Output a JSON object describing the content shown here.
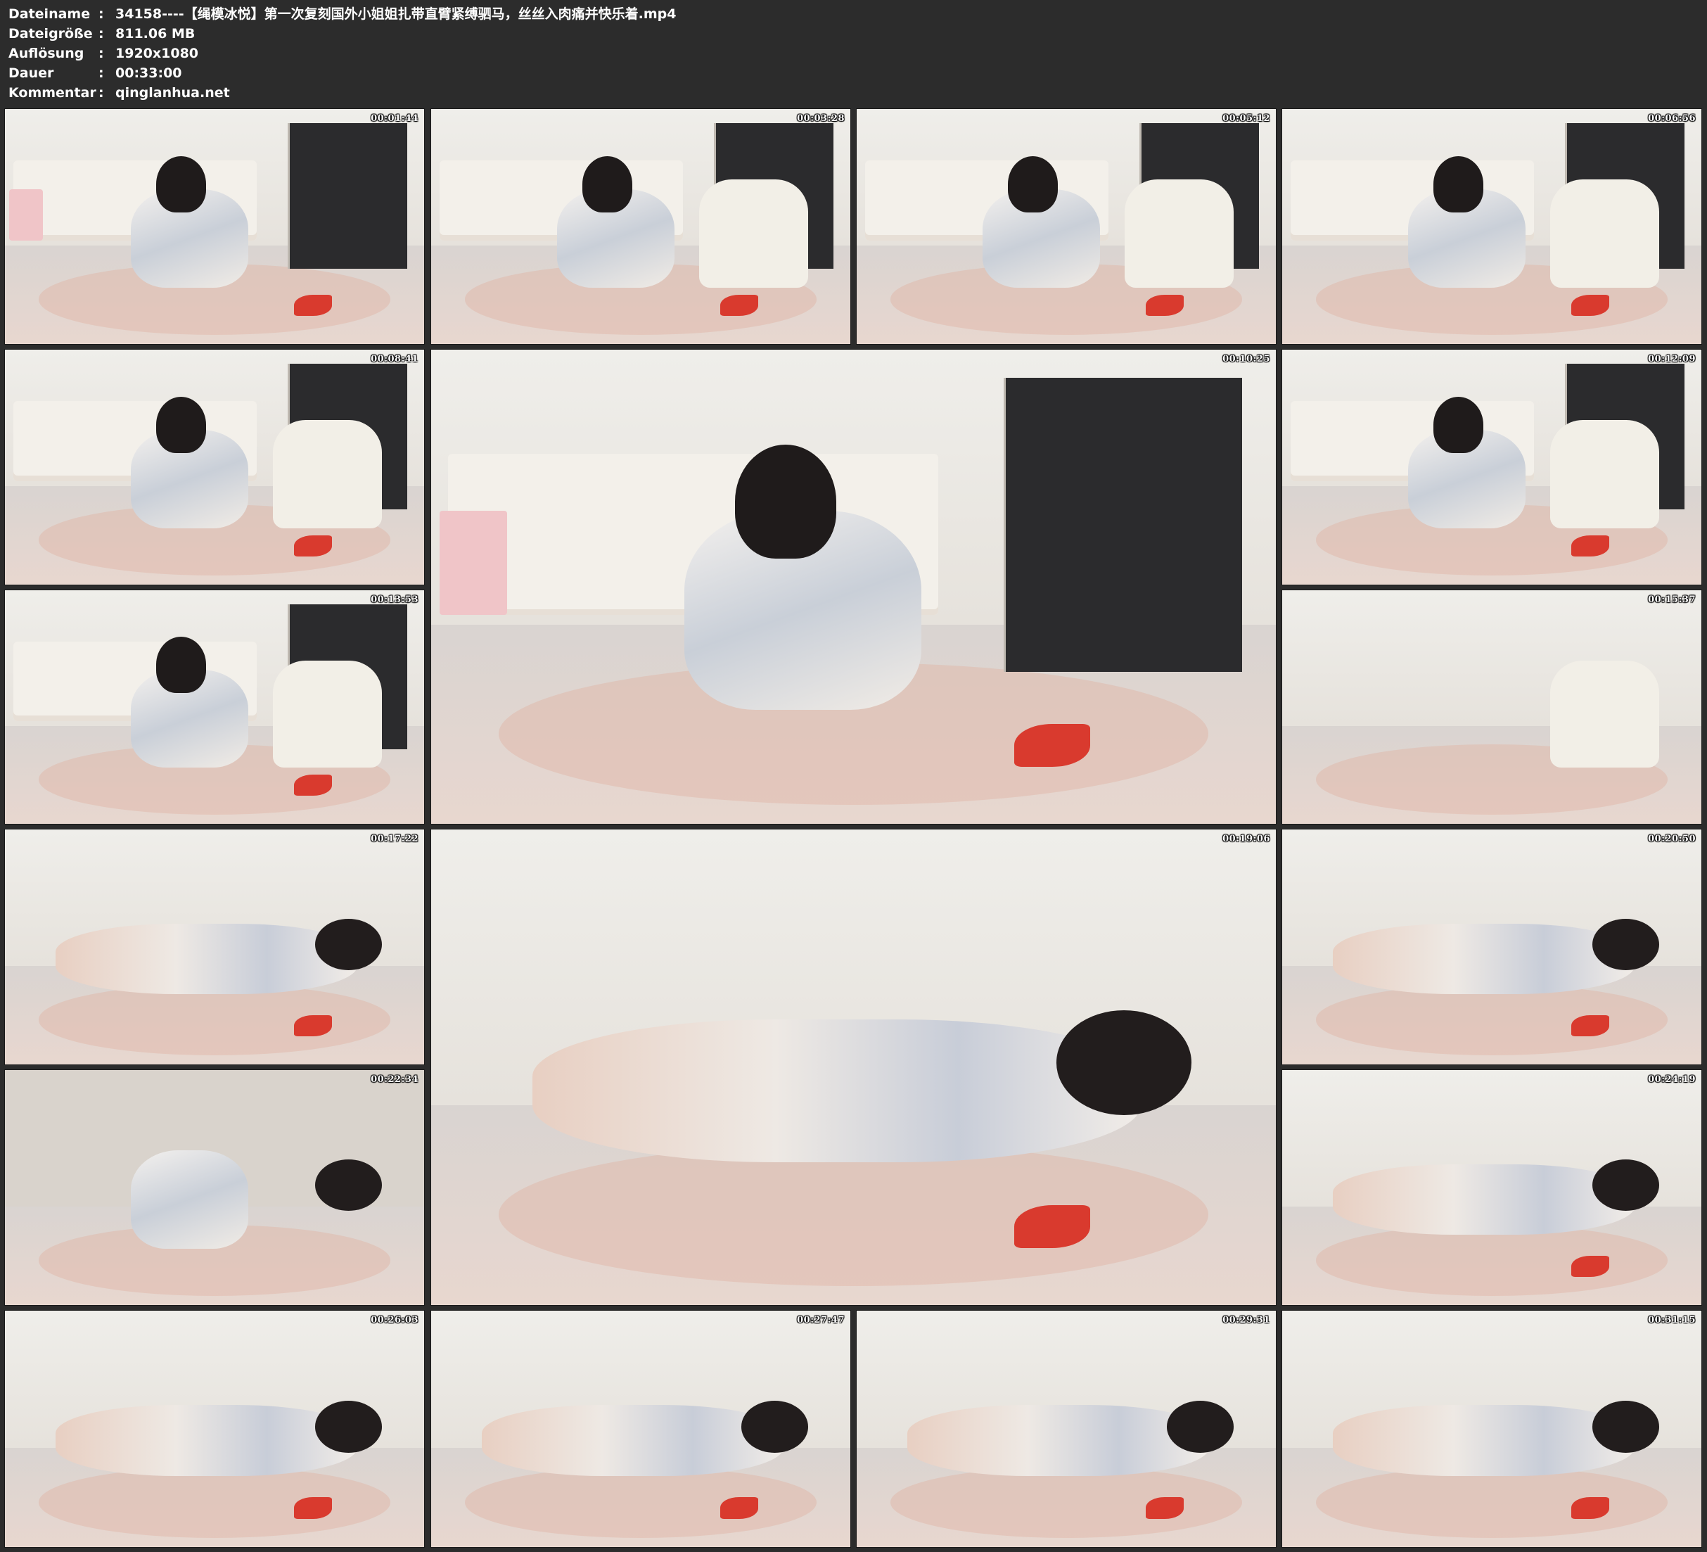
{
  "meta": [
    {
      "label": "Dateiname",
      "value": "34158----【绳模冰悦】第一次复刻国外小姐姐扎带直臂紧缚驷马，丝丝入肉痛并快乐着.mp4"
    },
    {
      "label": "Dateigröße",
      "value": "811.06 MB"
    },
    {
      "label": "Auflösung",
      "value": "1920x1080"
    },
    {
      "label": "Dauer",
      "value": "00:33:00"
    },
    {
      "label": "Kommentar",
      "value": "qinglanhua.net"
    }
  ],
  "separator": ":",
  "thumbnails": [
    {
      "time": "00:01:44",
      "scene": "seated-sofa"
    },
    {
      "time": "00:03:28",
      "scene": "seated-man"
    },
    {
      "time": "00:05:12",
      "scene": "seated-man"
    },
    {
      "time": "00:06:56",
      "scene": "seated-man"
    },
    {
      "time": "00:08:41",
      "scene": "seated-man"
    },
    {
      "time": "00:10:25",
      "scene": "seated-sofa"
    },
    {
      "time": "00:12:09",
      "scene": "seated-man"
    },
    {
      "time": "00:13:53",
      "scene": "seated-man"
    },
    {
      "time": "00:15:37",
      "scene": "jacket-closeup"
    },
    {
      "time": "00:17:22",
      "scene": "lying"
    },
    {
      "time": "00:19:06",
      "scene": "lying"
    },
    {
      "time": "00:20:50",
      "scene": "lying"
    },
    {
      "time": "00:22:34",
      "scene": "face-closeup"
    },
    {
      "time": "00:24:19",
      "scene": "lying"
    },
    {
      "time": "00:26:03",
      "scene": "lying"
    },
    {
      "time": "00:27:47",
      "scene": "lying"
    },
    {
      "time": "00:29:31",
      "scene": "lying"
    },
    {
      "time": "00:31:15",
      "scene": "lying"
    }
  ]
}
